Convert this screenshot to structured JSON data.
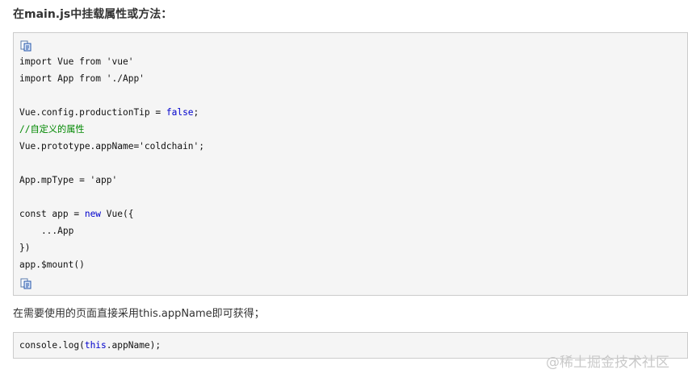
{
  "heading": "在main.js中挂载属性或方法：",
  "code_block_1": {
    "lines": [
      [
        {
          "t": "import Vue from 'vue'"
        }
      ],
      [
        {
          "t": "import App from './App'"
        }
      ],
      [
        {
          "t": ""
        }
      ],
      [
        {
          "t": "Vue.config.productionTip = "
        },
        {
          "t": "false",
          "c": "kw"
        },
        {
          "t": ";"
        }
      ],
      [
        {
          "t": "//自定义的属性",
          "c": "cm"
        }
      ],
      [
        {
          "t": "Vue.prototype.appName='coldchain';"
        }
      ],
      [
        {
          "t": ""
        }
      ],
      [
        {
          "t": "App.mpType = 'app'"
        }
      ],
      [
        {
          "t": ""
        }
      ],
      [
        {
          "t": "const app = "
        },
        {
          "t": "new",
          "c": "kw"
        },
        {
          "t": " Vue({"
        }
      ],
      [
        {
          "t": "    ...App"
        }
      ],
      [
        {
          "t": "})"
        }
      ],
      [
        {
          "t": "app.$mount()"
        }
      ]
    ]
  },
  "paragraph": "在需要使用的页面直接采用this.appName即可获得；",
  "code_block_2": {
    "segments": [
      {
        "t": "console.log("
      },
      {
        "t": "this",
        "c": "kw"
      },
      {
        "t": ".appName);"
      }
    ]
  },
  "watermark": "@稀土掘金技术社区",
  "icons": {
    "copy_icon_top": "copy-code-icon",
    "copy_icon_bottom": "copy-code-icon"
  },
  "colors": {
    "keyword": "#0000cc",
    "comment": "#008800",
    "code_background": "#f5f5f5",
    "code_border": "#cccccc"
  }
}
